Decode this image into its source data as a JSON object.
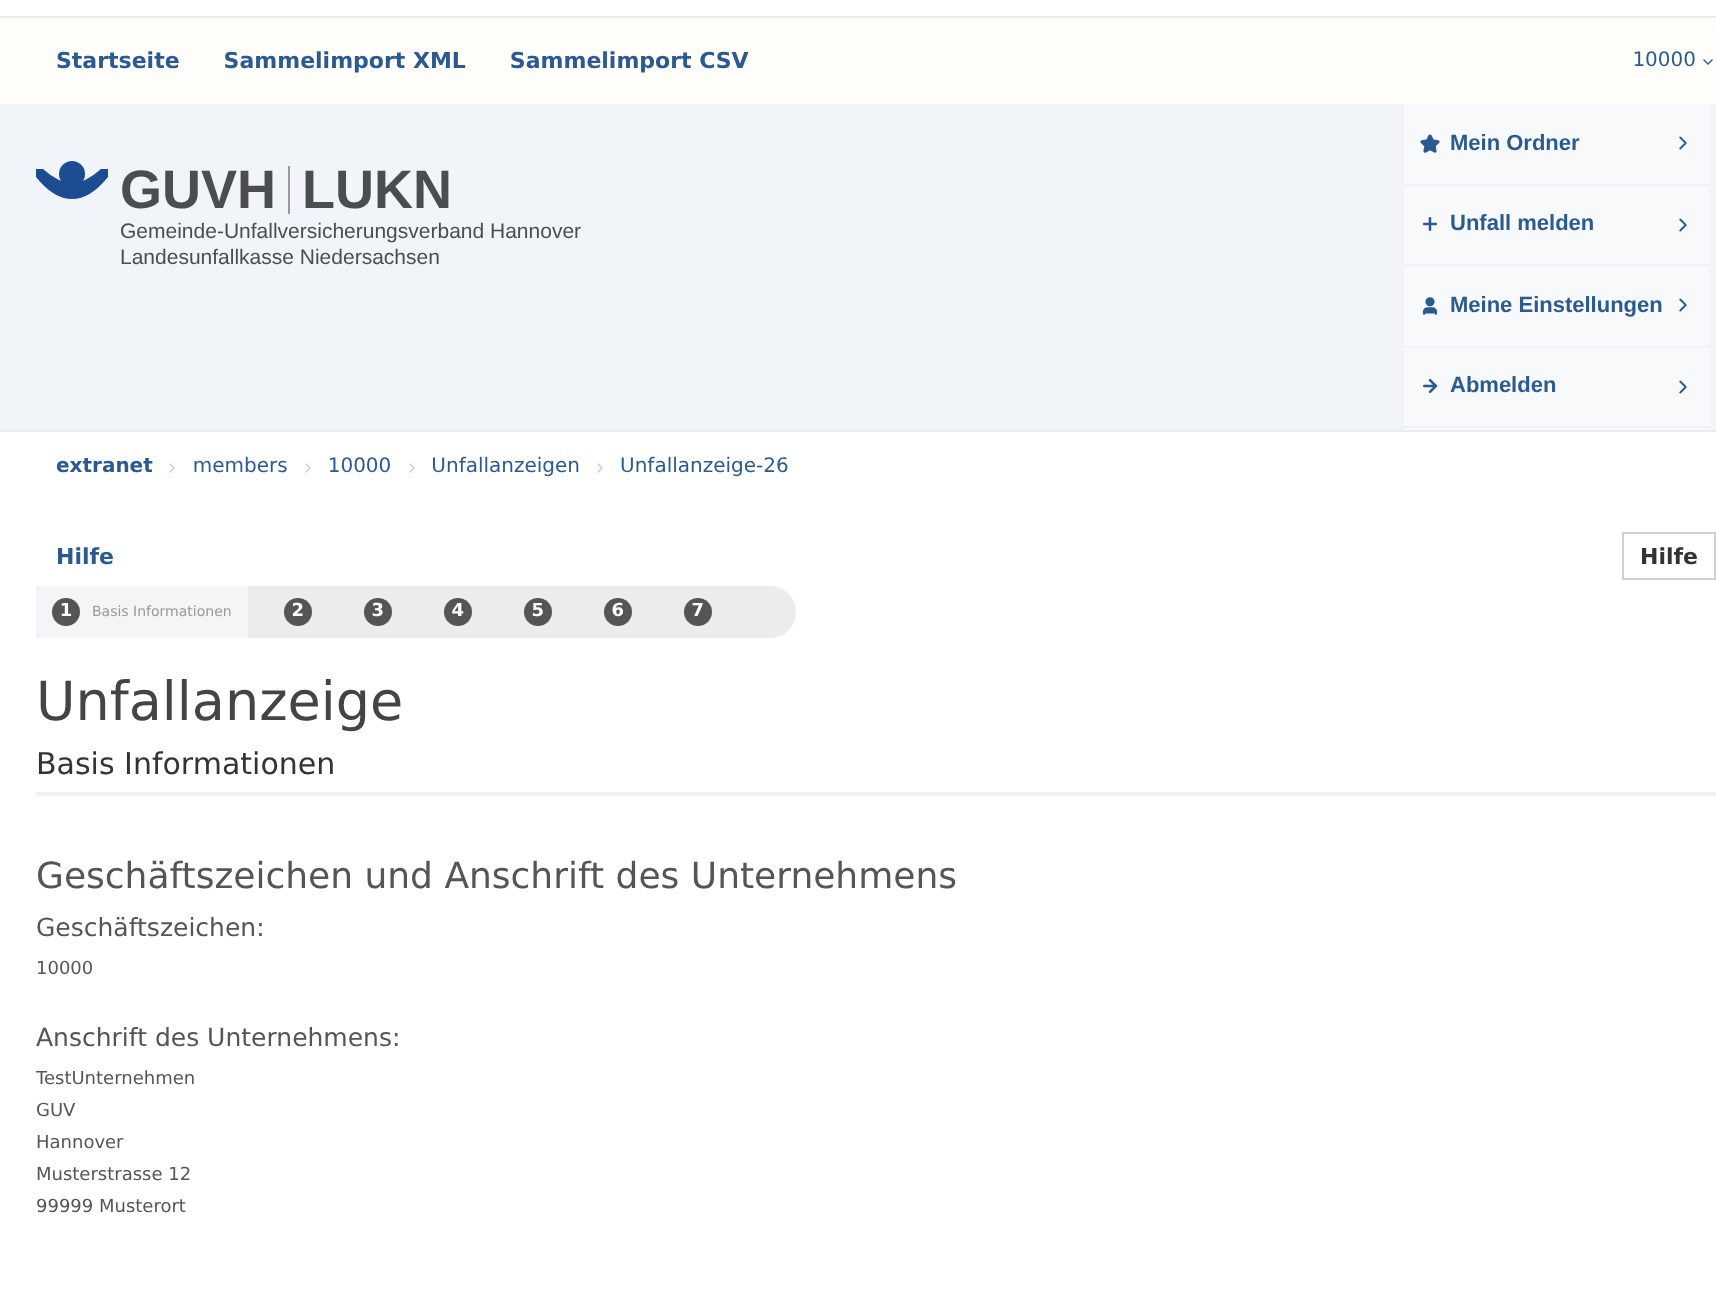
{
  "nav": {
    "links": [
      "Startseite",
      "Sammelimport XML",
      "Sammelimport CSV"
    ],
    "user": "10000"
  },
  "logo": {
    "title_left": "GUVH",
    "title_right": "LUKN",
    "lines": [
      "Gemeinde-Unfallversicherungsverband Hannover",
      "Landesunfallkasse Niedersachsen"
    ]
  },
  "side_menu": [
    {
      "kind": "star",
      "label": "Mein Ordner"
    },
    {
      "kind": "plus",
      "label": "Unfall melden"
    },
    {
      "kind": "user",
      "label": "Meine Einstellungen"
    },
    {
      "kind": "arrow",
      "label": "Abmelden"
    }
  ],
  "breadcrumb": [
    {
      "label": "extranet",
      "current": true
    },
    {
      "label": "members",
      "current": false
    },
    {
      "label": "10000",
      "current": false
    },
    {
      "label": "Unfallanzeigen",
      "current": false
    },
    {
      "label": "Unfallanzeige-26",
      "current": false
    }
  ],
  "help_link": "Hilfe",
  "help_button": "Hilfe",
  "steps": [
    {
      "number": "1",
      "label": "Basis Informationen",
      "selected": true
    },
    {
      "number": "2",
      "selected": false
    },
    {
      "number": "3",
      "selected": false
    },
    {
      "number": "4",
      "selected": false
    },
    {
      "number": "5",
      "selected": false
    },
    {
      "number": "6",
      "selected": false
    },
    {
      "number": "7",
      "selected": false
    }
  ],
  "title": "Unfallanzeige",
  "subtitle": "Basis Informationen",
  "section": {
    "heading": "Geschäftszeichen und Anschrift des Unternehmens",
    "fields": [
      {
        "label": "Geschäftszeichen:",
        "lines": [
          "10000"
        ]
      },
      {
        "label": "Anschrift des Unternehmens:",
        "lines": [
          "TestUnternehmen",
          "GUV",
          "Hannover",
          "Musterstrasse 12",
          "99999 Musterort"
        ]
      }
    ]
  }
}
